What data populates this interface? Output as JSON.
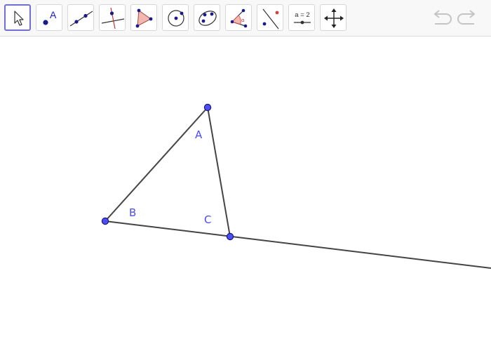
{
  "toolbar": {
    "tools": [
      {
        "id": "move",
        "name": "move-tool-button",
        "selected": true
      },
      {
        "id": "point",
        "name": "point-tool-button",
        "icon_text": "A"
      },
      {
        "id": "line",
        "name": "line-tool-button"
      },
      {
        "id": "perpendicular",
        "name": "perpendicular-line-tool-button"
      },
      {
        "id": "polygon",
        "name": "polygon-tool-button"
      },
      {
        "id": "circle",
        "name": "circle-tool-button"
      },
      {
        "id": "conic",
        "name": "conic-tool-button"
      },
      {
        "id": "angle",
        "name": "angle-tool-button",
        "icon_text": "α"
      },
      {
        "id": "reflect",
        "name": "reflect-tool-button"
      },
      {
        "id": "slider",
        "name": "slider-tool-button",
        "icon_text": "a = 2"
      },
      {
        "id": "move-view",
        "name": "move-graphics-view-tool-button"
      }
    ],
    "undo": "undo",
    "redo": "redo"
  },
  "canvas": {
    "labels": {
      "A": "A",
      "B": "B",
      "C": "C"
    },
    "colors": {
      "point_fill": "#4c4cff",
      "point_stroke": "#1a1a66",
      "segment": "#444444",
      "label": "#4a4aff"
    }
  }
}
